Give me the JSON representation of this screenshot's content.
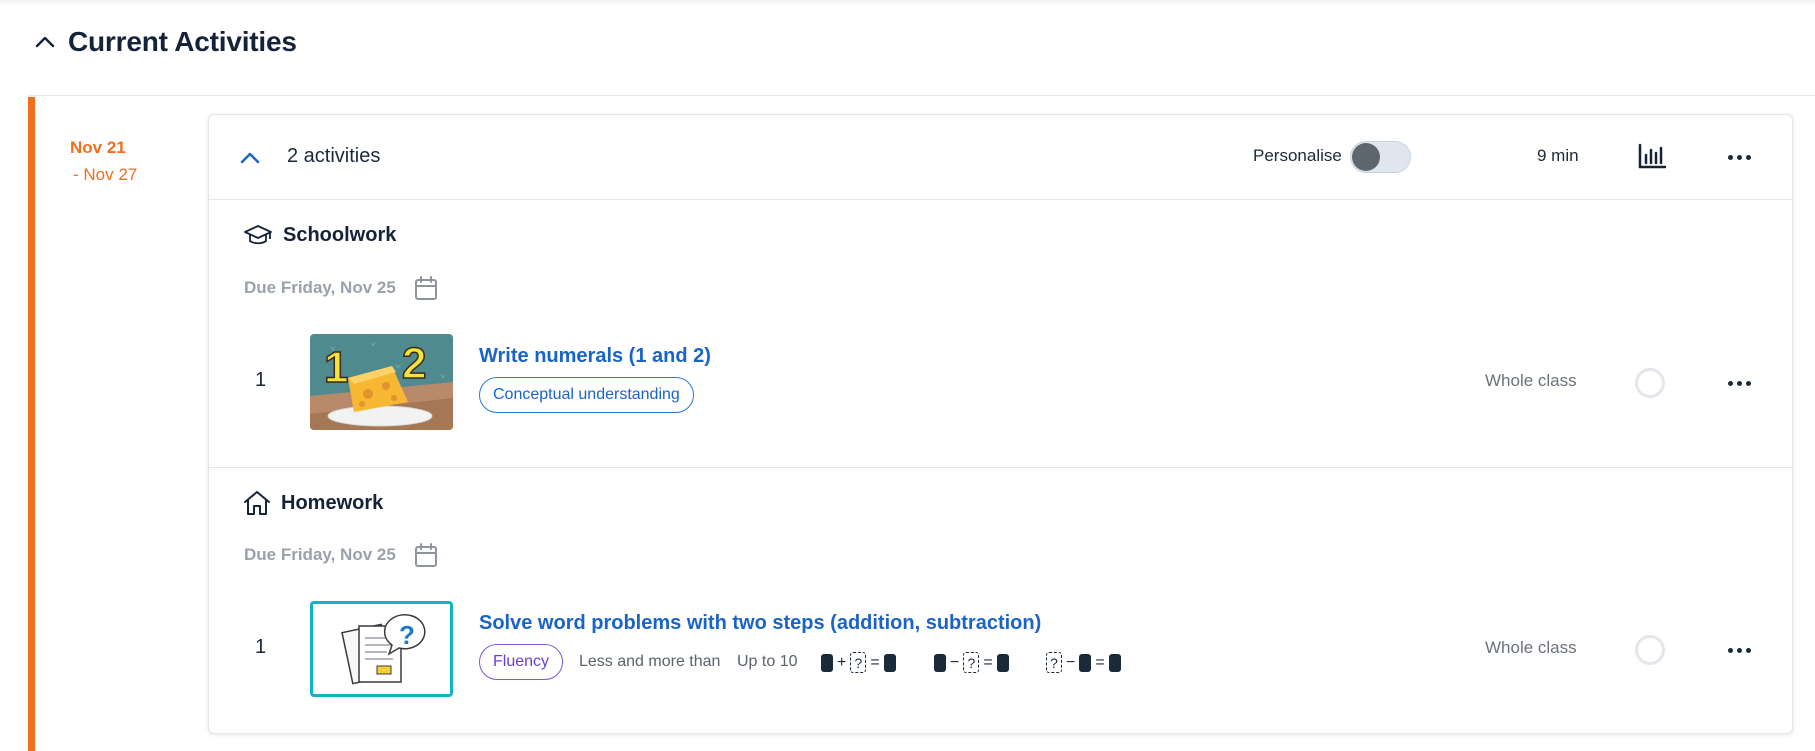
{
  "section": {
    "title": "Current Activities"
  },
  "week": {
    "start": "Nov 21",
    "end": "- Nov 27"
  },
  "card": {
    "activities_count": "2 activities",
    "personalise_label": "Personalise",
    "personalise_on": false,
    "duration": "9 min"
  },
  "groups": [
    {
      "title": "Schoolwork",
      "icon": "graduation-cap-icon",
      "due": "Due Friday, Nov 25",
      "activities": [
        {
          "number": "1",
          "title": "Write numerals (1 and 2)",
          "tag": "Conceptual understanding",
          "assignee": "Whole class"
        }
      ]
    },
    {
      "title": "Homework",
      "icon": "house-icon",
      "due": "Due Friday, Nov 25",
      "activities": [
        {
          "number": "1",
          "title": "Solve word problems with two steps (addition, subtraction)",
          "tag": "Fluency",
          "meta": [
            "Less and more than",
            "Up to 10"
          ],
          "equations": [
            {
              "ops": [
                "+",
                "="
              ],
              "q": "?"
            },
            {
              "ops": [
                "−",
                "="
              ],
              "q": "?"
            },
            {
              "ops": [
                "−",
                "="
              ],
              "q": "?"
            }
          ],
          "assignee": "Whole class"
        }
      ]
    }
  ],
  "colors": {
    "accent": "#f26d1d",
    "link": "#1a63c9",
    "tag_blue": "#2a78d8",
    "tag_purple": "#7d56e0",
    "thumb_border": "#12b3c7"
  }
}
